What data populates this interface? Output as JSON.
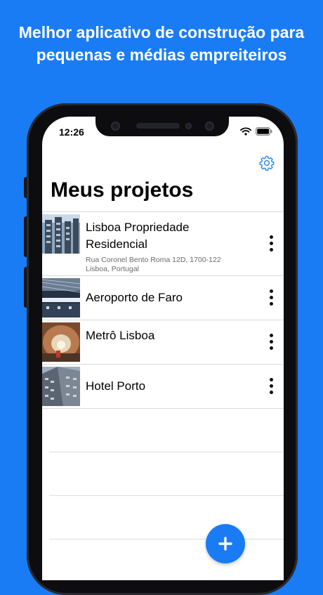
{
  "promo": {
    "headline_line1": "Melhor aplicativo de construção para",
    "headline_line2": "pequenas e médias empreiteiros"
  },
  "status_bar": {
    "time": "12:26",
    "icons": [
      "wifi-icon",
      "battery-icon"
    ]
  },
  "header": {
    "title": "Meus projetos",
    "settings_icon": "gear-icon"
  },
  "projects": [
    {
      "name_line1": "Lisboa Propriedade",
      "name_line2": "Residencial",
      "address_line1": "Rua Coronel Bento Roma 12D, 1700-122",
      "address_line2": "Lisboa, Portugal"
    },
    {
      "name_line1": "Aeroporto de Faro"
    },
    {
      "name_line1": "Metrô Lisboa"
    },
    {
      "name_line1": "Hotel Porto"
    }
  ],
  "fab": {
    "icon": "plus-icon"
  },
  "colors": {
    "brand": "#1a7cf5",
    "accent_icon": "#2f8cf0"
  }
}
